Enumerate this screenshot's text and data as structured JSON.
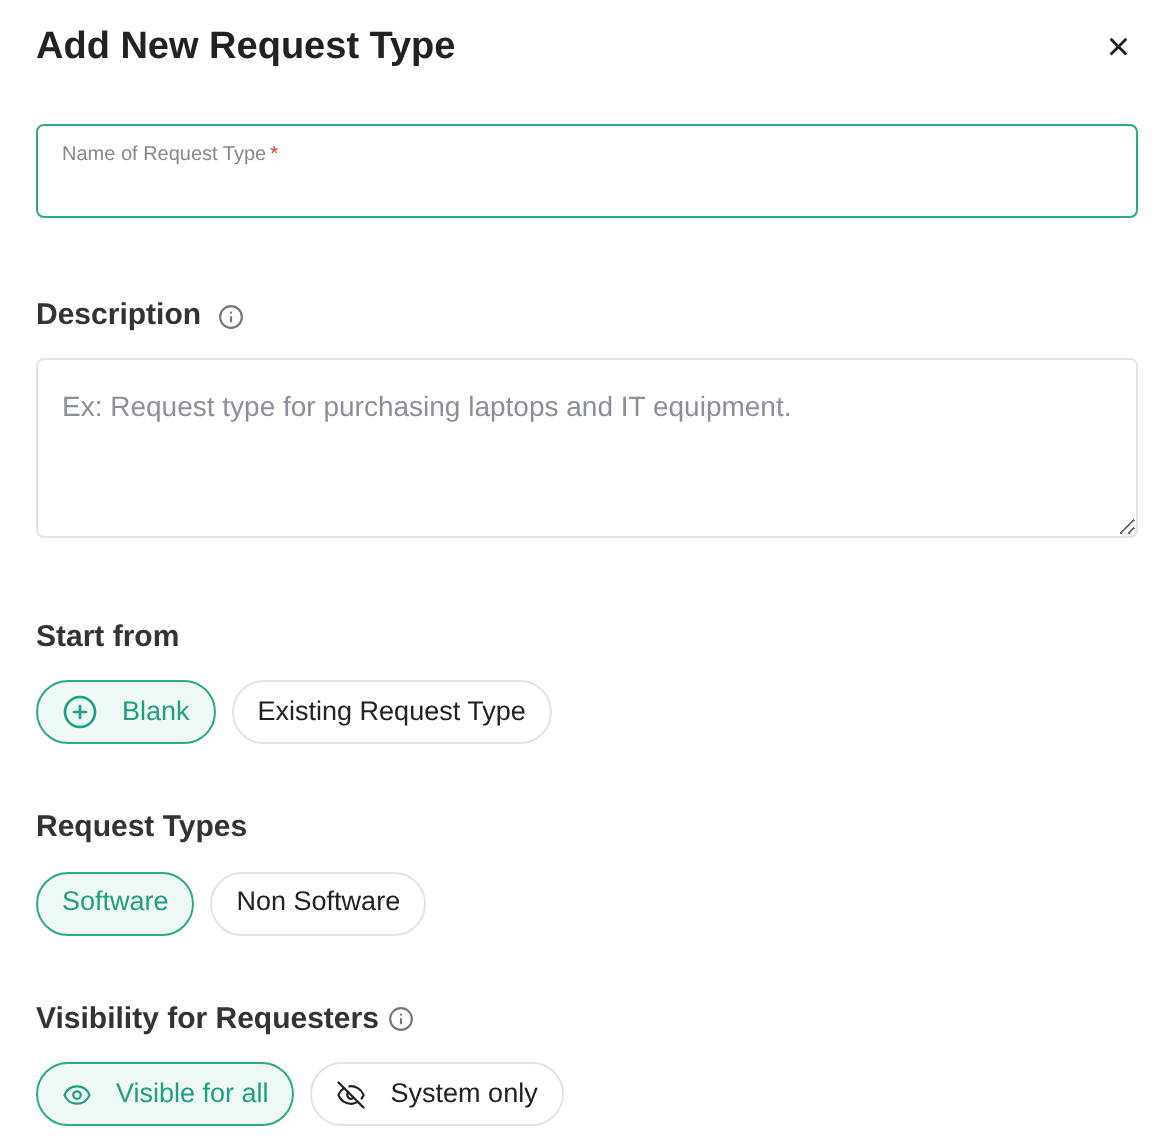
{
  "dialog": {
    "title": "Add New Request Type",
    "close": "×"
  },
  "name_field": {
    "label": "Name of Request Type",
    "required_mark": "*",
    "focused": true
  },
  "description": {
    "label": "Description",
    "placeholder": "Ex: Request type for purchasing laptops and IT equipment."
  },
  "groups": [
    {
      "label": "Start from",
      "info": false,
      "options": [
        {
          "label": "Blank",
          "selected": true
        },
        {
          "label": "Existing Request Type",
          "selected": false
        }
      ]
    },
    {
      "label": "Request Types",
      "info": false,
      "options": [
        {
          "label": "Software",
          "selected": true
        },
        {
          "label": "Non Software",
          "selected": false
        }
      ]
    },
    {
      "label": "Visibility for Requesters",
      "info": true,
      "options": [
        {
          "label": "Visible for all",
          "selected": true
        },
        {
          "label": "System only",
          "selected": false
        }
      ]
    }
  ]
}
